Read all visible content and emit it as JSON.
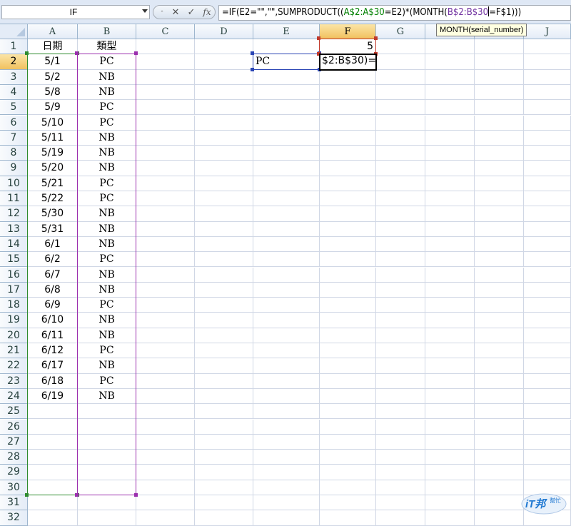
{
  "name_box": "IF",
  "formula_bar": {
    "cancel_label": "✕",
    "enter_label": "✓",
    "fx_label": "fx",
    "segments": [
      {
        "text": "=IF(E2=\"\",\"\",SUMPRODUCT((",
        "color": "black"
      },
      {
        "text": "A$2:A$30",
        "color": "green"
      },
      {
        "text": "=E2)*(MONTH(",
        "color": "black"
      },
      {
        "text": "B$2:B$30",
        "color": "purple"
      },
      {
        "text": "=F$1)))",
        "color": "black"
      }
    ]
  },
  "tooltip": "MONTH(serial_number)",
  "columns": [
    "A",
    "B",
    "C",
    "D",
    "E",
    "F",
    "G",
    "H",
    "I",
    "J"
  ],
  "selected_column": "F",
  "selected_row": 2,
  "rows": [
    "1",
    "2",
    "3",
    "4",
    "5",
    "6",
    "7",
    "8",
    "9",
    "10",
    "11",
    "12",
    "13",
    "14",
    "15",
    "16",
    "17",
    "18",
    "19",
    "20",
    "21",
    "22",
    "23",
    "24",
    "25",
    "26",
    "27",
    "28",
    "29",
    "30",
    "31",
    "32"
  ],
  "header": {
    "A": "日期",
    "B": "類型"
  },
  "data_rows": [
    {
      "date": "5/1",
      "type": "PC"
    },
    {
      "date": "5/2",
      "type": "NB"
    },
    {
      "date": "5/8",
      "type": "NB"
    },
    {
      "date": "5/9",
      "type": "PC"
    },
    {
      "date": "5/10",
      "type": "PC"
    },
    {
      "date": "5/11",
      "type": "NB"
    },
    {
      "date": "5/19",
      "type": "NB"
    },
    {
      "date": "5/20",
      "type": "NB"
    },
    {
      "date": "5/21",
      "type": "PC"
    },
    {
      "date": "5/22",
      "type": "PC"
    },
    {
      "date": "5/30",
      "type": "NB"
    },
    {
      "date": "5/31",
      "type": "NB"
    },
    {
      "date": "6/1",
      "type": "NB"
    },
    {
      "date": "6/2",
      "type": "PC"
    },
    {
      "date": "6/7",
      "type": "NB"
    },
    {
      "date": "6/8",
      "type": "NB"
    },
    {
      "date": "6/9",
      "type": "PC"
    },
    {
      "date": "6/10",
      "type": "NB"
    },
    {
      "date": "6/11",
      "type": "NB"
    },
    {
      "date": "6/12",
      "type": "PC"
    },
    {
      "date": "6/17",
      "type": "NB"
    },
    {
      "date": "6/18",
      "type": "PC"
    },
    {
      "date": "6/19",
      "type": "NB"
    }
  ],
  "cell_F1": "5",
  "cell_E2": "PC",
  "cell_F2_editing": "$2:B$30)=",
  "watermark": {
    "main": "iT邦",
    "sub": "幫忙"
  },
  "colors": {
    "range_a": "#2e8b2e",
    "range_b": "#9b2fae",
    "range_e": "#2a45b5",
    "range_f": "#c0392b",
    "header_bg": "#e4ecf7",
    "header_selected": "#f1c15f",
    "gridline": "#d0d7e5"
  }
}
